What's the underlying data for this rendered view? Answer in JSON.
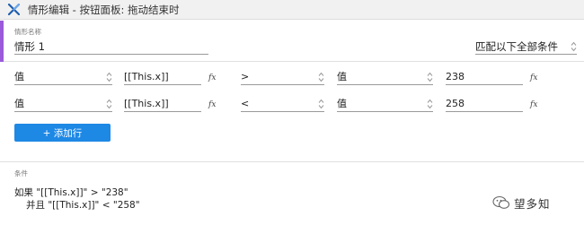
{
  "window": {
    "title": "情形编辑  -  按钮面板: 拖动结束时"
  },
  "case_name": {
    "label": "情形名称",
    "value": "情形 1"
  },
  "match_mode": {
    "selected": "匹配以下全部条件"
  },
  "fx_label": "fx",
  "conditions": [
    {
      "left_type": "值",
      "left_value": "[[This.x]]",
      "operator": ">",
      "right_type": "值",
      "right_value": "238"
    },
    {
      "left_type": "值",
      "left_value": "[[This.x]]",
      "operator": "<",
      "right_type": "值",
      "right_value": "258"
    }
  ],
  "add_row_button": "+ 添加行",
  "summary": {
    "label": "条件",
    "line1": "如果 \"[[This.x]]\" > \"238\"",
    "line2": "并且 \"[[This.x]]\" < \"258\""
  },
  "watermark": {
    "text": "望多知"
  },
  "colors": {
    "accent": "#9a5ad9",
    "button": "#1e88e5",
    "app_icon": "#1f5fb0"
  }
}
